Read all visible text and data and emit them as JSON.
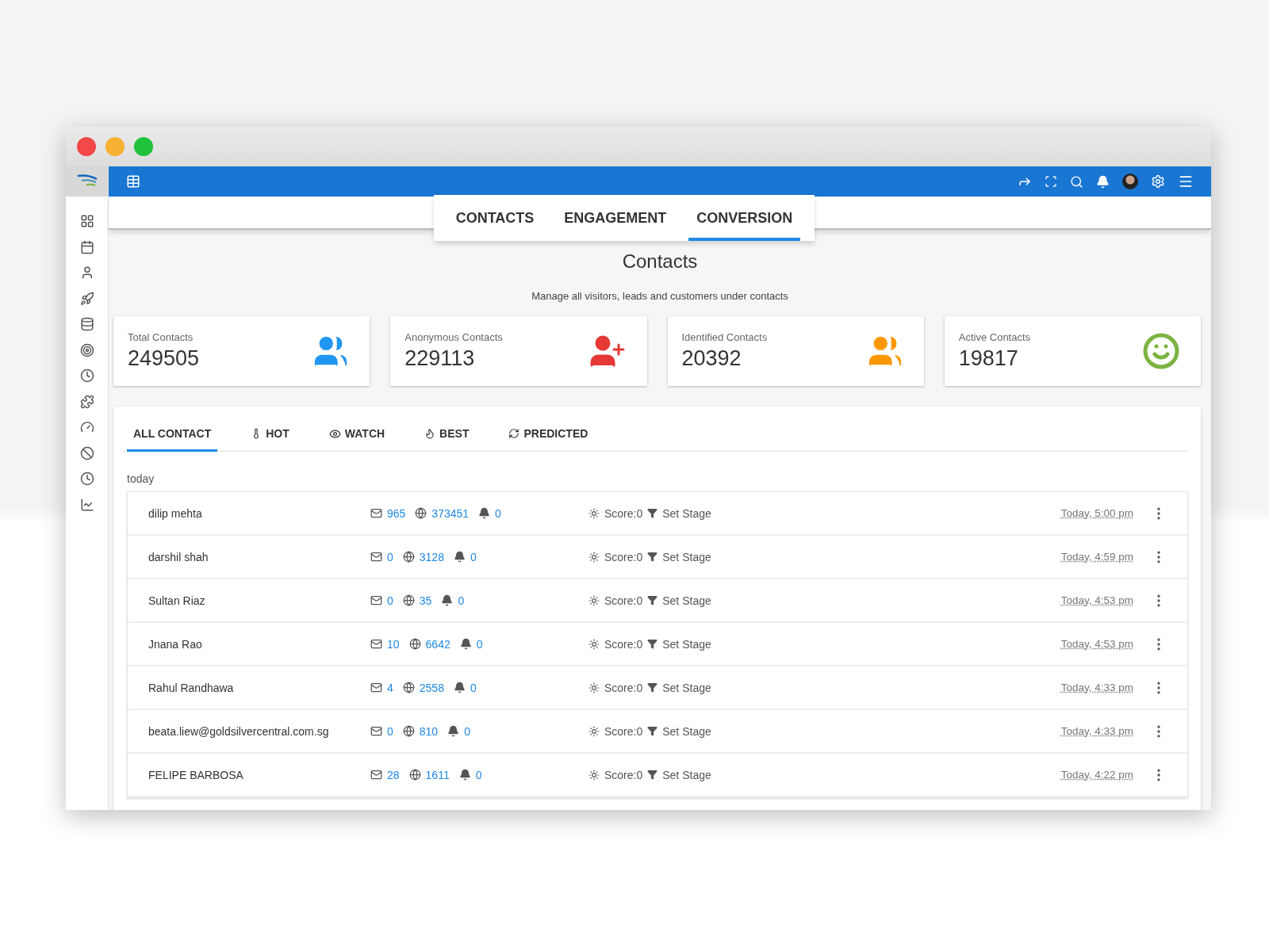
{
  "main_tabs": [
    {
      "label": "CONTACTS",
      "selected": false
    },
    {
      "label": "ENGAGEMENT",
      "selected": false
    },
    {
      "label": "CONVERSION",
      "selected": true
    }
  ],
  "page_title": "Contacts",
  "subtitle": "Manage all visitors, leads and customers under contacts",
  "stat_cards": [
    {
      "label": "Total Contacts",
      "value": "249505",
      "kind": "group",
      "color": "#2196f3"
    },
    {
      "label": "Anonymous Contacts",
      "value": "229113",
      "kind": "add",
      "color": "#e53935"
    },
    {
      "label": "Identified Contacts",
      "value": "20392",
      "kind": "group",
      "color": "#ff9800"
    },
    {
      "label": "Active Contacts",
      "value": "19817",
      "kind": "face",
      "color": "#7cb342"
    }
  ],
  "filter_tabs": [
    {
      "label": "ALL CONTACT",
      "kind": "none",
      "selected": true
    },
    {
      "label": "HOT",
      "kind": "thermometer",
      "selected": false
    },
    {
      "label": "WATCH",
      "kind": "eye",
      "selected": false
    },
    {
      "label": "BEST",
      "kind": "flame",
      "selected": false
    },
    {
      "label": "PREDICTED",
      "kind": "cycle",
      "selected": false
    }
  ],
  "group_label": "today",
  "contacts": [
    {
      "name": "dilip mehta",
      "emails": "965",
      "visits": "373451",
      "alerts": "0",
      "score": "Score:0",
      "stage": "Set Stage",
      "time": "Today, 5:00 pm"
    },
    {
      "name": "darshil shah",
      "emails": "0",
      "visits": "3128",
      "alerts": "0",
      "score": "Score:0",
      "stage": "Set Stage",
      "time": "Today, 4:59 pm"
    },
    {
      "name": "Sultan Riaz",
      "emails": "0",
      "visits": "35",
      "alerts": "0",
      "score": "Score:0",
      "stage": "Set Stage",
      "time": "Today, 4:53 pm"
    },
    {
      "name": "Jnana Rao",
      "emails": "10",
      "visits": "6642",
      "alerts": "0",
      "score": "Score:0",
      "stage": "Set Stage",
      "time": "Today, 4:53 pm"
    },
    {
      "name": "Rahul Randhawa",
      "emails": "4",
      "visits": "2558",
      "alerts": "0",
      "score": "Score:0",
      "stage": "Set Stage",
      "time": "Today, 4:33 pm"
    },
    {
      "name": "beata.liew@goldsilvercentral.com.sg",
      "emails": "0",
      "visits": "810",
      "alerts": "0",
      "score": "Score:0",
      "stage": "Set Stage",
      "time": "Today, 4:33 pm"
    },
    {
      "name": "FELIPE BARBOSA",
      "emails": "28",
      "visits": "1611",
      "alerts": "0",
      "score": "Score:0",
      "stage": "Set Stage",
      "time": "Today, 4:22 pm"
    }
  ]
}
